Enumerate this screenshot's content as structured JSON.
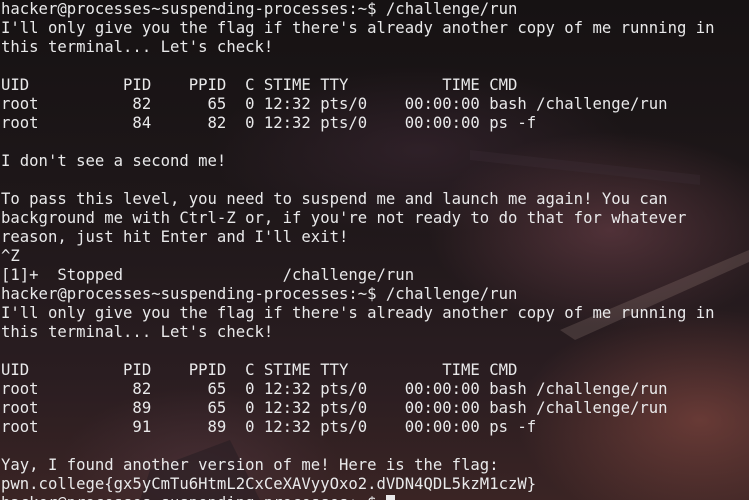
{
  "terminal": {
    "lines": [
      "hacker@processes~suspending-processes:~$ /challenge/run",
      "I'll only give you the flag if there's already another copy of me running in",
      "this terminal... Let's check!",
      "",
      "UID          PID    PPID  C STIME TTY          TIME CMD",
      "root          82      65  0 12:32 pts/0    00:00:00 bash /challenge/run",
      "root          84      82  0 12:32 pts/0    00:00:00 ps -f",
      "",
      "I don't see a second me!",
      "",
      "To pass this level, you need to suspend me and launch me again! You can",
      "background me with Ctrl-Z or, if you're not ready to do that for whatever",
      "reason, just hit Enter and I'll exit!",
      "^Z",
      "[1]+  Stopped                 /challenge/run",
      "hacker@processes~suspending-processes:~$ /challenge/run",
      "I'll only give you the flag if there's already another copy of me running in",
      "this terminal... Let's check!",
      "",
      "UID          PID    PPID  C STIME TTY          TIME CMD",
      "root          82      65  0 12:32 pts/0    00:00:00 bash /challenge/run",
      "root          89      65  0 12:32 pts/0    00:00:00 bash /challenge/run",
      "root          91      89  0 12:32 pts/0    00:00:00 ps -f",
      "",
      "Yay, I found another version of me! Here is the flag:",
      "pwn.college{gx5yCmTu6HtmL2CxCeXAVyyOxo2.dVDN4QDL5kzM1czW}",
      "hacker@processes~suspending-processes:~$ "
    ]
  }
}
